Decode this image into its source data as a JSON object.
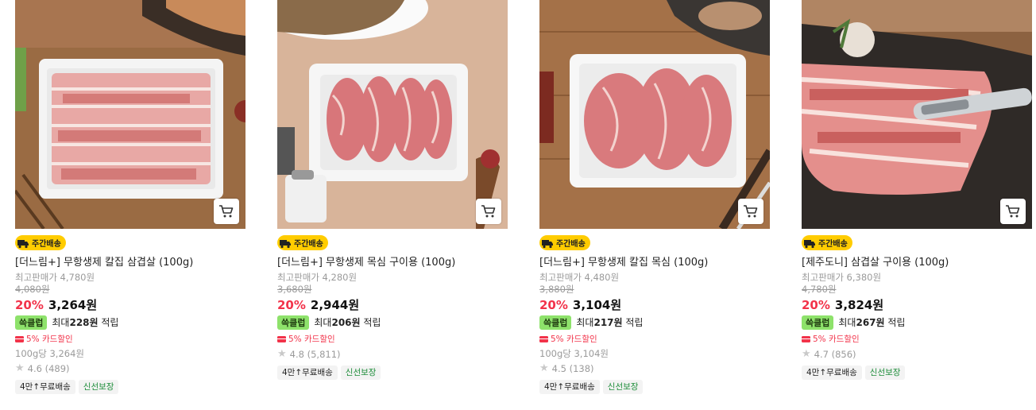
{
  "products": [
    {
      "badge": "주간배송",
      "name": "[더느림+] 무항생제 칼집 삼겹살 (100g)",
      "max_price": "최고판매가 4,780원",
      "original_price": "4,080원",
      "discount": "20%",
      "price": "3,264원",
      "point_chip": "쓱클럽",
      "point_prefix": "최대",
      "point_amount": "228원",
      "point_suffix": "적립",
      "card_discount": "5% 카드할인",
      "unit_price": "100g당 3,264원",
      "rating": "4.6",
      "reviews": "(489)",
      "tags": [
        "4만↑무료배송",
        "신선보장"
      ]
    },
    {
      "badge": "주간배송",
      "name": "[더느림+] 무항생제 목심 구이용 (100g)",
      "max_price": "최고판매가 4,280원",
      "original_price": "3,680원",
      "discount": "20%",
      "price": "2,944원",
      "point_chip": "쓱클럽",
      "point_prefix": "최대",
      "point_amount": "206원",
      "point_suffix": "적립",
      "card_discount": "5% 카드할인",
      "unit_price": "",
      "rating": "4.8",
      "reviews": "(5,811)",
      "tags": [
        "4만↑무료배송",
        "신선보장"
      ]
    },
    {
      "badge": "주간배송",
      "name": "[더느림+] 무항생제 칼집 목심 (100g)",
      "max_price": "최고판매가 4,480원",
      "original_price": "3,880원",
      "discount": "20%",
      "price": "3,104원",
      "point_chip": "쓱클럽",
      "point_prefix": "최대",
      "point_amount": "217원",
      "point_suffix": "적립",
      "card_discount": "5% 카드할인",
      "unit_price": "100g당 3,104원",
      "rating": "4.5",
      "reviews": "(138)",
      "tags": [
        "4만↑무료배송",
        "신선보장"
      ]
    },
    {
      "badge": "주간배송",
      "name": "[제주도니] 삼겹살 구이용 (100g)",
      "max_price": "최고판매가 6,380원",
      "original_price": "4,780원",
      "discount": "20%",
      "price": "3,824원",
      "point_chip": "쓱클럽",
      "point_prefix": "최대",
      "point_amount": "267원",
      "point_suffix": "적립",
      "card_discount": "5% 카드할인",
      "unit_price": "",
      "rating": "4.7",
      "reviews": "(856)",
      "tags": [
        "4만↑무료배송",
        "신선보장"
      ]
    }
  ],
  "icons": {
    "cart": "cart-icon",
    "truck": "delivery-truck-icon",
    "star": "star-icon",
    "card": "credit-card-icon"
  },
  "colors": {
    "discount": "#f2334a",
    "badge": "#ffcc00",
    "point_chip": "#8ee26b",
    "tag_green": "#1e8d3a"
  }
}
